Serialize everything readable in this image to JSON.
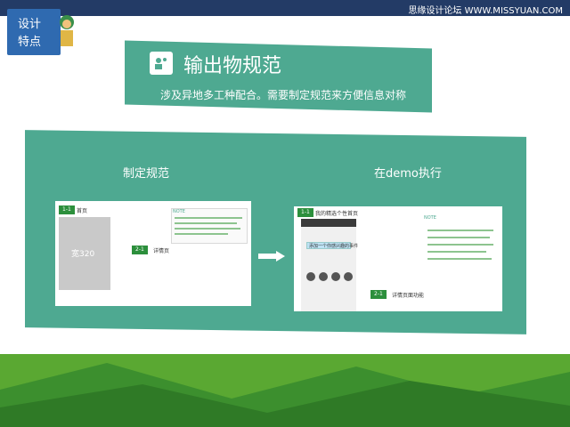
{
  "watermark": "思缘设计论坛 WWW.MISSYUAN.COM",
  "corner": {
    "line1": "设计",
    "line2": "特点"
  },
  "title": "输出物规范",
  "subtitle": "涉及异地多工种配合。需要制定规范来方便信息对称",
  "left_section": {
    "label": "制定规范",
    "tag_top": "1-1",
    "page_name": "首页",
    "placeholder": "宽320",
    "tag_mid": "2-1",
    "detail_name": "详情页",
    "note_title": "NOTE"
  },
  "right_section": {
    "label": "在demo执行",
    "tag_top": "1-1",
    "top_text": "我的精选个性首页",
    "note_title": "NOTE",
    "phone_btn": "添加一个你感兴趣的事件",
    "tag_bottom": "2-1",
    "bottom_text": "详情页面功能"
  },
  "colors": {
    "panel": "#4ea991",
    "topbar": "#233b66",
    "badge": "#2f6ab0",
    "tag": "#2c8f3c",
    "footer_green": "#5aa832"
  }
}
